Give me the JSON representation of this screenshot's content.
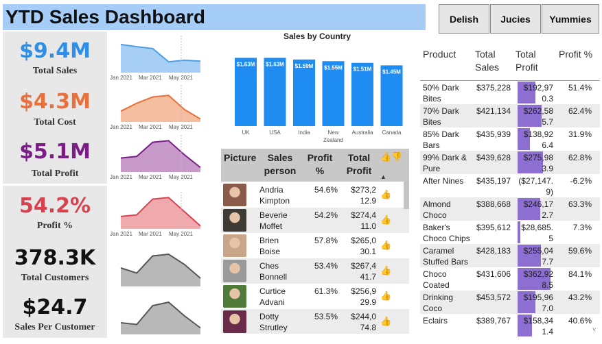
{
  "title": "YTD Sales Dashboard",
  "kpis": [
    {
      "value": "$9.4M",
      "label": "Total Sales",
      "color": "#2e8fe8"
    },
    {
      "value": "$4.3M",
      "label": "Total Cost",
      "color": "#e8703c"
    },
    {
      "value": "$5.1M",
      "label": "Total Profit",
      "color": "#7a1e86"
    },
    {
      "value": "54.2%",
      "label": "Profit %",
      "color": "#d8424e"
    },
    {
      "value": "378.3K",
      "label": "Total Customers",
      "color": "#111111"
    },
    {
      "value": "$24.7",
      "label": "Sales Per Customer",
      "color": "#111111"
    }
  ],
  "sparkline_ticks": [
    "Jan 2021",
    "Mar 2021",
    "May 2021"
  ],
  "sparklines": [
    {
      "values": [
        0.85,
        0.78,
        0.72,
        0.3,
        0.35,
        0.32
      ],
      "color": "#4a9fe8",
      "fill": "#a7cff5"
    },
    {
      "values": [
        0.3,
        0.55,
        0.75,
        0.8,
        0.35,
        0.05
      ],
      "color": "#e8703c",
      "fill": "#f5bea0"
    },
    {
      "values": [
        0.4,
        0.45,
        0.9,
        0.95,
        0.5,
        0.1
      ],
      "color": "#7a1e86",
      "fill": "#c79ac9"
    },
    {
      "values": [
        0.35,
        0.4,
        0.9,
        0.95,
        0.5,
        0.05
      ],
      "color": "#d8424e",
      "fill": "#f0a9ad"
    },
    {
      "values": [
        0.5,
        0.35,
        0.85,
        0.9,
        0.6,
        0.2
      ],
      "color": "#555555",
      "fill": "#b8b8b8"
    },
    {
      "values": [
        0.3,
        0.25,
        0.8,
        0.9,
        0.5,
        0.15
      ],
      "color": "#555555",
      "fill": "#b8b8b8"
    }
  ],
  "chart_data": {
    "type": "bar",
    "title": "Sales by Country",
    "categories": [
      "UK",
      "USA",
      "India",
      "New Zealand",
      "Australia",
      "Canada"
    ],
    "values": [
      1.63,
      1.63,
      1.59,
      1.55,
      1.51,
      1.45
    ],
    "data_labels": [
      "$1.63M",
      "$1.63M",
      "$1.59M",
      "$1.55M",
      "$1.51M",
      "$1.45M"
    ],
    "ylim": [
      0,
      1.8
    ],
    "color": "#1e8cf0"
  },
  "sales_table": {
    "headers": [
      "Picture",
      "Sales person",
      "Profit %",
      "Total Profit"
    ],
    "rows": [
      {
        "name": "Andria Kimpton",
        "profit_pct": "54.6%",
        "total_profit": "$273,212.9",
        "avatar_color": "#8a5a4a"
      },
      {
        "name": "Beverie Moffet",
        "profit_pct": "54.2%",
        "total_profit": "$274,411.0",
        "avatar_color": "#3e3a36"
      },
      {
        "name": "Brien Boise",
        "profit_pct": "57.8%",
        "total_profit": "$265,030.1",
        "avatar_color": "#c9a58a"
      },
      {
        "name": "Ches Bonnell",
        "profit_pct": "53.4%",
        "total_profit": "$267,441.7",
        "avatar_color": "#9a9a9a"
      },
      {
        "name": "Curtice Advani",
        "profit_pct": "61.3%",
        "total_profit": "$256,929.9",
        "avatar_color": "#4f7a3a"
      },
      {
        "name": "Dotty Strutley",
        "profit_pct": "53.5%",
        "total_profit": "$244,074.8",
        "avatar_color": "#6a2c48"
      }
    ]
  },
  "slicers": [
    "Delish",
    "Jucies",
    "Yummies"
  ],
  "product_table": {
    "headers": [
      "Product",
      "Total Sales",
      "Total Profit",
      "Profit %"
    ],
    "rows": [
      {
        "product": "50% Dark Bites",
        "sales": "$375,228",
        "profit": "$192,970.3",
        "profit_value": 192970,
        "pct": "51.4%"
      },
      {
        "product": "70% Dark Bites",
        "sales": "$421,134",
        "profit": "$262,585.7",
        "profit_value": 262585,
        "pct": "62.4%"
      },
      {
        "product": "85% Dark Bars",
        "sales": "$435,939",
        "profit": "$138,926.4",
        "profit_value": 138926,
        "pct": "31.9%"
      },
      {
        "product": "99% Dark & Pure",
        "sales": "$439,628",
        "profit": "$275,983.9",
        "profit_value": 275983,
        "pct": "62.8%"
      },
      {
        "product": "After Nines",
        "sales": "$435,197",
        "profit": "($27,147.9)",
        "profit_value": -27147,
        "pct": "-6.2%"
      },
      {
        "product": "Almond Choco",
        "sales": "$388,668",
        "profit": "$246,172.7",
        "profit_value": 246172,
        "pct": "63.3%"
      },
      {
        "product": "Baker's Choco Chips",
        "sales": "$395,612",
        "profit": "$28,685.5",
        "profit_value": 28685,
        "pct": "7.3%"
      },
      {
        "product": "Caramel Stuffed Bars",
        "sales": "$428,183",
        "profit": "$255,047.7",
        "profit_value": 255047,
        "pct": "59.6%"
      },
      {
        "product": "Choco Coated Almonds",
        "sales": "$431,606",
        "profit": "$362,928.5",
        "profit_value": 362928,
        "pct": "84.1%"
      },
      {
        "product": "Drinking Coco",
        "sales": "$453,572",
        "profit": "$195,967.0",
        "profit_value": 195967,
        "pct": "43.2%"
      },
      {
        "product": "Eclairs",
        "sales": "$389,767",
        "profit": "$158,341.4",
        "profit_value": 158341,
        "pct": "40.6%"
      }
    ]
  }
}
